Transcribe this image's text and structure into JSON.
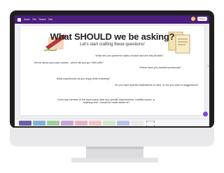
{
  "toolbar": {
    "menu": [
      "Home",
      "File",
      "Resize",
      "Edit"
    ],
    "share_label": "Share"
  },
  "slide": {
    "title": "What SHOULD we be asking?",
    "subtitle": "Let's start crafting these questions!",
    "questions": [
      "What are your preferred dates of travel and are they flexible?",
      "Tell me about your past cruises - where did you go? Who with?",
      "Where have you traveled previously?",
      "What experiences do you enjoy when traveling?",
      "Do you have specific destinations in mind, or are you open to suggestions?",
      "Does any member of the travel party have any specific requirements, mobility issues, or anything else I should be made aware of?"
    ]
  },
  "filmstrip": {
    "thumb_colors": [
      "#6b5fa8",
      "#7fb3d5",
      "#9fcf9f",
      "#c9a3d9",
      "#e7b3c9",
      "#f0c7c7",
      "#d6e7c9",
      "#b9c3e9",
      "#e9e9e9"
    ]
  },
  "colors": {
    "toolbar_bg": "#4b1f7f",
    "slide_bg": "#ffffff",
    "bezel": "#1f1f1f"
  }
}
